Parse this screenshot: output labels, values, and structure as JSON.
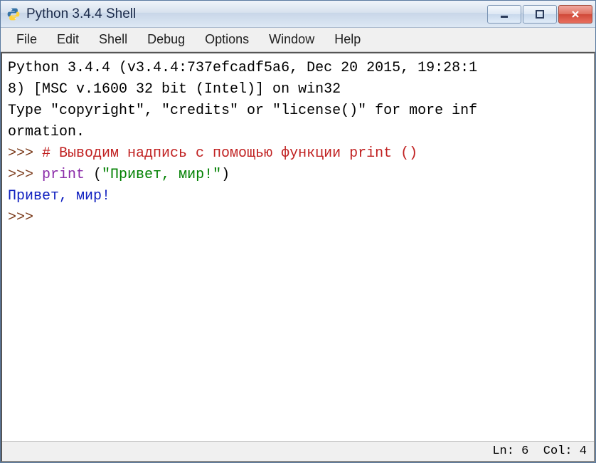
{
  "window": {
    "title": "Python 3.4.4 Shell"
  },
  "menu": {
    "file": "File",
    "edit": "Edit",
    "shell": "Shell",
    "debug": "Debug",
    "options": "Options",
    "window": "Window",
    "help": "Help"
  },
  "shell": {
    "banner_line1": "Python 3.4.4 (v3.4.4:737efcadf5a6, Dec 20 2015, 19:28:1",
    "banner_line2": "8) [MSC v.1600 32 bit (Intel)] on win32",
    "banner_line3": "Type \"copyright\", \"credits\" or \"license()\" for more inf",
    "banner_line4": "ormation.",
    "prompt": ">>> ",
    "comment": "# Выводим надпись с помощью функции print ()",
    "builtin": "print",
    "code_after": " (",
    "string": "\"Привет, мир!\"",
    "code_close": ")",
    "output": "Привет, мир!"
  },
  "status": {
    "ln_label": "Ln:",
    "ln_value": "6",
    "col_label": "Col:",
    "col_value": "4"
  }
}
